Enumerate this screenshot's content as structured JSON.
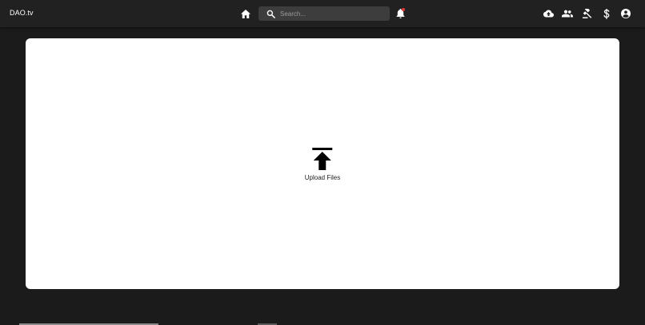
{
  "app": {
    "brand": "DAO.tv"
  },
  "topbar": {
    "home_icon": "home-icon",
    "search": {
      "placeholder": "Search...",
      "value": "",
      "icon": "search-icon"
    },
    "notifications": {
      "icon": "bell-icon",
      "has_unread": true,
      "dot_color": "#e53935"
    },
    "actions": [
      {
        "icon": "cloud-upload-icon"
      },
      {
        "icon": "people-icon"
      },
      {
        "icon": "gavel-icon"
      },
      {
        "icon": "dollar-icon"
      },
      {
        "icon": "account-circle-icon"
      }
    ]
  },
  "main": {
    "upload": {
      "icon": "upload-icon",
      "label": "Upload Files"
    }
  },
  "colors": {
    "background": "#1b1b1b",
    "topbar": "#212121",
    "search_bg": "#3d3d3d",
    "card": "#ffffff",
    "icon": "#ffffff",
    "text_dark": "#222222"
  }
}
